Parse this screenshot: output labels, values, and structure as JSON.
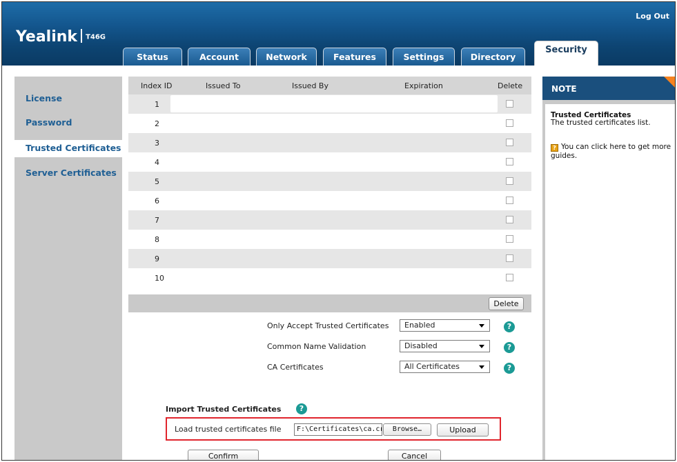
{
  "header": {
    "brand": "Yealink",
    "model": "T46G",
    "logout_label": "Log Out"
  },
  "tabs": [
    {
      "label": "Status"
    },
    {
      "label": "Account"
    },
    {
      "label": "Network"
    },
    {
      "label": "Features"
    },
    {
      "label": "Settings"
    },
    {
      "label": "Directory"
    },
    {
      "label": "Security",
      "active": true
    }
  ],
  "sidebar": {
    "items": [
      {
        "label": "License"
      },
      {
        "label": "Password"
      },
      {
        "label": "Trusted Certificates",
        "active": true
      },
      {
        "label": "Server Certificates"
      }
    ]
  },
  "table": {
    "headers": [
      "Index ID",
      "Issued To",
      "Issued By",
      "Expiration",
      "Delete"
    ],
    "rows": [
      {
        "index": "1"
      },
      {
        "index": "2"
      },
      {
        "index": "3"
      },
      {
        "index": "4"
      },
      {
        "index": "5"
      },
      {
        "index": "6"
      },
      {
        "index": "7"
      },
      {
        "index": "8"
      },
      {
        "index": "9"
      },
      {
        "index": "10"
      }
    ],
    "delete_button": "Delete"
  },
  "options": [
    {
      "label": "Only Accept Trusted Certificates",
      "value": "Enabled"
    },
    {
      "label": "Common Name Validation",
      "value": "Disabled"
    },
    {
      "label": "CA Certificates",
      "value": "All Certificates"
    }
  ],
  "import": {
    "title": "Import Trusted Certificates",
    "load_label": "Load trusted certificates file",
    "file_value": "F:\\Certificates\\ca.cr",
    "browse_label": "Browse…",
    "upload_label": "Upload"
  },
  "actions": {
    "confirm_label": "Confirm",
    "cancel_label": "Cancel"
  },
  "note": {
    "title": "NOTE",
    "subtitle": "Trusted Certificates",
    "description": "The trusted certificates list.",
    "guide": "You can click here to get more guides.",
    "guide_icon_glyph": "?"
  },
  "help_glyph": "?",
  "colors": {
    "header_blue": "#14578f",
    "nav_link": "#1f5f94",
    "note_header": "#1a4f7d",
    "note_corner": "#f58220",
    "help_icon": "#1b9a95",
    "highlight_box": "#e0242c"
  }
}
